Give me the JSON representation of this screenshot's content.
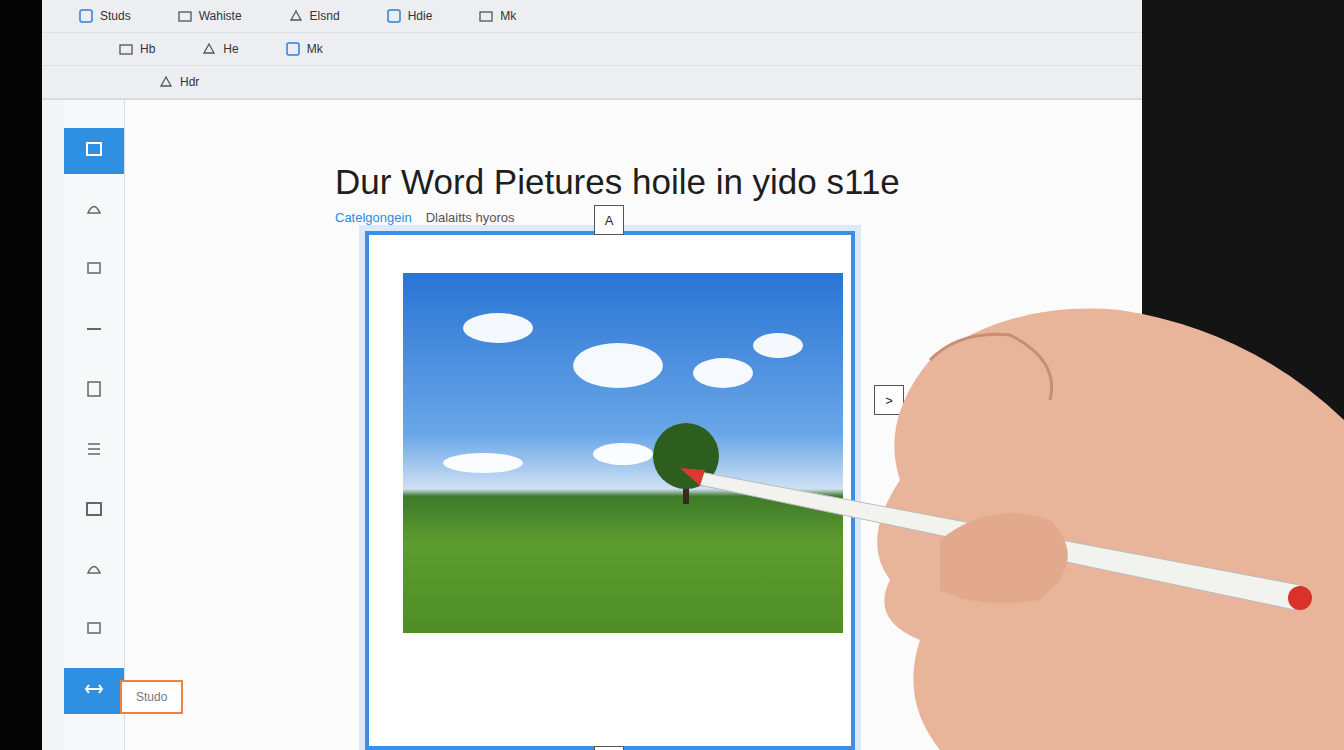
{
  "toolbar": {
    "rows": [
      [
        "Studs",
        "Wahiste",
        "Elsnd",
        "Hdie",
        "Mk"
      ],
      [
        "Hb",
        "He",
        "Mk"
      ],
      [
        "Hdr"
      ]
    ]
  },
  "sidebar": {
    "items": [
      {
        "selected": true
      },
      {
        "selected": false
      },
      {
        "selected": false
      },
      {
        "selected": false
      },
      {
        "selected": false
      },
      {
        "selected": false
      },
      {
        "selected": false
      },
      {
        "selected": false
      },
      {
        "selected": false
      },
      {
        "selected": true
      }
    ]
  },
  "document": {
    "title": "Dur Word Pietures hoile in yido s11e",
    "link": "Catelgongein",
    "subtitle": "Dlalaitts hyoros"
  },
  "handles": {
    "top": "A",
    "right": ">",
    "bottom": "×"
  },
  "bottom_button": "Studo"
}
